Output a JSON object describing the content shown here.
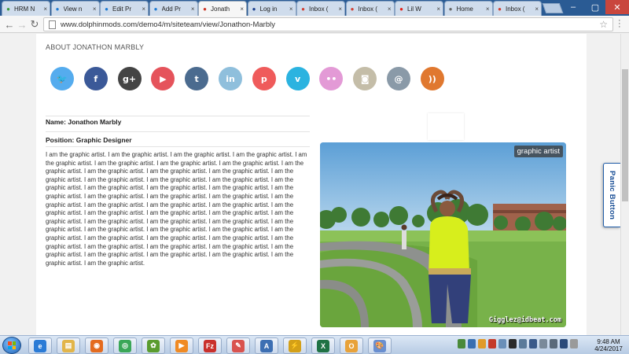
{
  "browser": {
    "tabs": [
      {
        "label": "HRM N",
        "icon": "leaf-icon",
        "color": "#3a9a3a"
      },
      {
        "label": "View n",
        "icon": "infinity-icon",
        "color": "#1f7bd3"
      },
      {
        "label": "Edit Pr",
        "icon": "infinity-icon",
        "color": "#1f7bd3"
      },
      {
        "label": "Add Pr",
        "icon": "infinity-icon",
        "color": "#1f7bd3"
      },
      {
        "label": "Jonath",
        "icon": "dolphin-icon",
        "color": "#cc3322"
      },
      {
        "label": "Log in",
        "icon": "paypal-icon",
        "color": "#1a3f8e"
      },
      {
        "label": "Inbox (",
        "icon": "gmail-icon",
        "color": "#d23f31"
      },
      {
        "label": "Inbox (",
        "icon": "gmail-icon",
        "color": "#d23f31"
      },
      {
        "label": "Lil W",
        "icon": "youtube-icon",
        "color": "#e62117"
      },
      {
        "label": "Home",
        "icon": "home-icon",
        "color": "#666666"
      },
      {
        "label": "Inbox (",
        "icon": "gmail-icon",
        "color": "#d23f31"
      }
    ],
    "active_tab": 4,
    "url": "www.dolphinmods.com/demo4/m/siteteam/view/Jonathon-Marbly"
  },
  "page": {
    "heading": "ABOUT JONATHON MARBLY",
    "social": [
      {
        "name": "twitter",
        "glyph": "🐦",
        "color": "#55acee"
      },
      {
        "name": "facebook",
        "glyph": "f",
        "color": "#3b5998"
      },
      {
        "name": "google-plus",
        "glyph": "g+",
        "color": "#444444"
      },
      {
        "name": "youtube",
        "glyph": "▶",
        "color": "#e5535b"
      },
      {
        "name": "tumblr",
        "glyph": "t",
        "color": "#4b6b8f"
      },
      {
        "name": "linkedin",
        "glyph": "in",
        "color": "#8fbfdc"
      },
      {
        "name": "pinterest",
        "glyph": "p",
        "color": "#ef5b5b"
      },
      {
        "name": "vimeo",
        "glyph": "v",
        "color": "#2bb3e0"
      },
      {
        "name": "flickr",
        "glyph": "••",
        "color": "#e39ad6"
      },
      {
        "name": "instagram",
        "glyph": "◙",
        "color": "#c4bda8"
      },
      {
        "name": "email",
        "glyph": "@",
        "color": "#8a9aa8"
      },
      {
        "name": "rss",
        "glyph": "))",
        "color": "#e0782f"
      }
    ],
    "name_line": "Name: Jonathon Marbly",
    "position_line": "Position: Graphic Designer",
    "bio": "I am the graphic artist. I am the graphic artist. I am the graphic artist. I am the graphic artist. I am the graphic artist. I am the graphic artist. I am the graphic artist. I am the graphic artist. I am the graphic artist. I am the graphic artist. I am the graphic artist. I am the graphic artist. I am the graphic artist. I am the graphic artist. I am the graphic artist. I am the graphic artist. I am the graphic artist. I am the graphic artist. I am the graphic artist. I am the graphic artist. I am the graphic artist. I am the graphic artist. I am the graphic artist. I am the graphic artist. I am the graphic artist. I am the graphic artist. I am the graphic artist. I am the graphic artist. I am the graphic artist. I am the graphic artist. I am the graphic artist. I am the graphic artist. I am the graphic artist. I am the graphic artist. I am the graphic artist. I am the graphic artist. I am the graphic artist. I am the graphic artist. I am the graphic artist. I am the graphic artist. I am the graphic artist. I am the graphic artist. I am the graphic artist. I am the graphic artist. I am the graphic artist. I am the graphic artist. I am the graphic artist. I am the graphic artist. I am the graphic artist. I am the graphic artist. I am the graphic artist. I am the graphic artist. I am the graphic artist. I am the graphic artist.",
    "photo_tag": "graphic artist",
    "photo_credit": "Gigglez@idbeat.com",
    "panic_button": "Panic Button"
  },
  "taskbar": {
    "apps": [
      {
        "name": "internet-explorer",
        "color": "#2b7bd6",
        "glyph": "e"
      },
      {
        "name": "file-explorer",
        "color": "#e2b54a",
        "glyph": "▤"
      },
      {
        "name": "firefox",
        "color": "#e46b1f",
        "glyph": "◉"
      },
      {
        "name": "chrome",
        "color": "#3aa757",
        "glyph": "◎"
      },
      {
        "name": "frogger",
        "color": "#5a9c2e",
        "glyph": "✿"
      },
      {
        "name": "media-player",
        "color": "#f08a24",
        "glyph": "▶"
      },
      {
        "name": "filezilla",
        "color": "#c9302c",
        "glyph": "Fz"
      },
      {
        "name": "eraser",
        "color": "#d9534f",
        "glyph": "✎"
      },
      {
        "name": "font-viewer",
        "color": "#3d6fb3",
        "glyph": "A"
      },
      {
        "name": "winamp",
        "color": "#d4a017",
        "glyph": "⚡"
      },
      {
        "name": "excel",
        "color": "#1f7244",
        "glyph": "X"
      },
      {
        "name": "outlook",
        "color": "#e8a23a",
        "glyph": "O"
      },
      {
        "name": "paint",
        "color": "#6a8fd0",
        "glyph": "🎨"
      }
    ],
    "time": "9:48 AM",
    "date": "4/24/2017"
  }
}
